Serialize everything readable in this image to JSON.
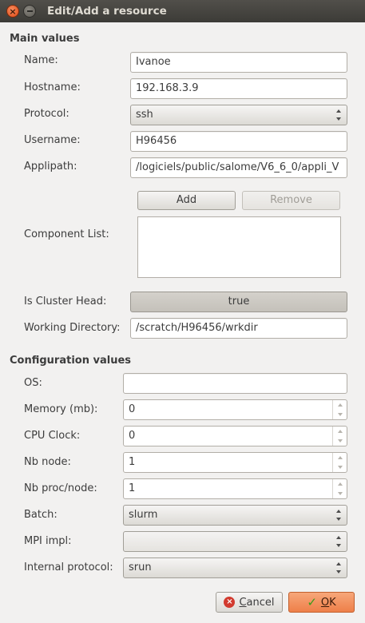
{
  "window": {
    "title": "Edit/Add a resource"
  },
  "main_values": {
    "heading": "Main values",
    "name": {
      "label": "Name:",
      "value": "Ivanoe"
    },
    "hostname": {
      "label": "Hostname:",
      "value": "192.168.3.9"
    },
    "protocol": {
      "label": "Protocol:",
      "value": "ssh"
    },
    "username": {
      "label": "Username:",
      "value": "H96456"
    },
    "applipath": {
      "label": "Applipath:",
      "value": "/logiciels/public/salome/V6_6_0/appli_V"
    },
    "add_label": "Add",
    "remove_label": "Remove",
    "component_list": {
      "label": "Component List:",
      "items": []
    },
    "is_cluster_head": {
      "label": "Is Cluster Head:",
      "value": "true"
    },
    "working_directory": {
      "label": "Working Directory:",
      "value": "/scratch/H96456/wrkdir"
    }
  },
  "configuration_values": {
    "heading": "Configuration values",
    "os": {
      "label": "OS:",
      "value": ""
    },
    "memory": {
      "label": "Memory (mb):",
      "value": "0"
    },
    "cpu_clock": {
      "label": "CPU Clock:",
      "value": "0"
    },
    "nb_node": {
      "label": "Nb node:",
      "value": "1"
    },
    "nb_proc_node": {
      "label": "Nb proc/node:",
      "value": "1"
    },
    "batch": {
      "label": "Batch:",
      "value": "slurm"
    },
    "mpi_impl": {
      "label": "MPI impl:",
      "value": ""
    },
    "internal_protocol": {
      "label": "Internal protocol:",
      "value": "srun"
    }
  },
  "buttons": {
    "cancel_label": "Cancel",
    "ok_label": "OK"
  },
  "icons": {
    "close": "close-icon",
    "minimize": "minimize-icon",
    "cancel": "cancel-icon",
    "ok": "checkmark-icon"
  },
  "colors": {
    "titlebar": "#3c3b37",
    "ok_button": "#ee7f49",
    "close_button": "#df4b16"
  }
}
